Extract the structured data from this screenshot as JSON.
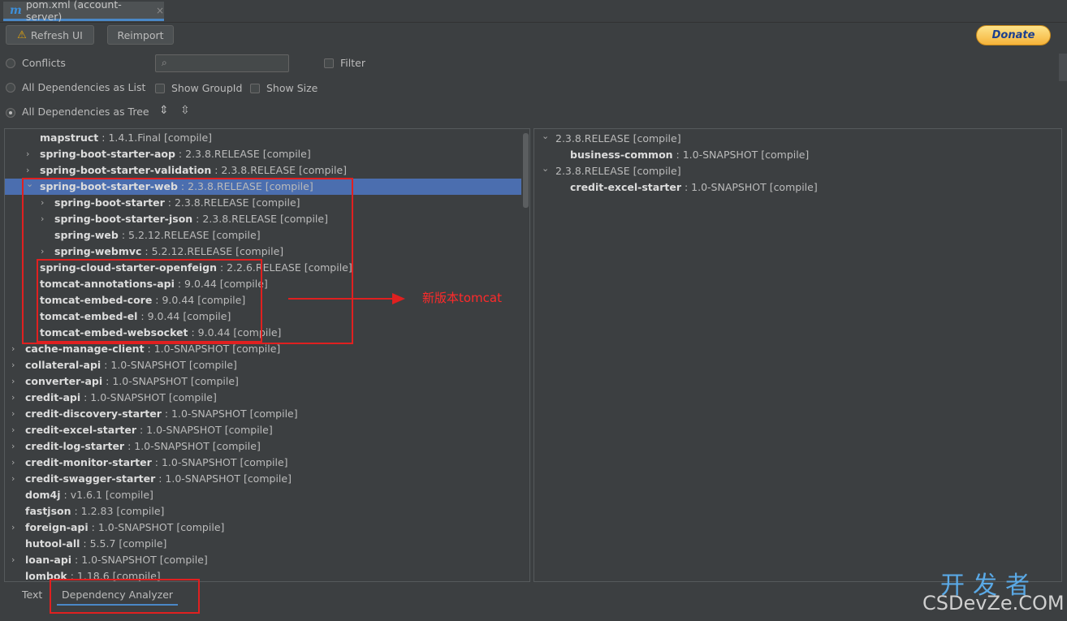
{
  "tab": {
    "title": "pom.xml (account-server)",
    "icon": "m",
    "close": "×"
  },
  "toolbar": {
    "refresh_label": "Refresh UI",
    "reimport_label": "Reimport",
    "donate_label": "Donate"
  },
  "options": {
    "conflicts": "Conflicts",
    "filter": "Filter",
    "as_list": "All Dependencies as List",
    "show_group_id": "Show GroupId",
    "show_size": "Show Size",
    "as_tree": "All Dependencies as Tree"
  },
  "tree": [
    {
      "name": "mapstruct",
      "version": " : 1.4.1.Final [compile]",
      "level": 1,
      "arrow": ""
    },
    {
      "name": "spring-boot-starter-aop",
      "version": " : 2.3.8.RELEASE [compile]",
      "level": 1,
      "arrow": "›"
    },
    {
      "name": "spring-boot-starter-validation",
      "version": " : 2.3.8.RELEASE [compile]",
      "level": 1,
      "arrow": "›"
    },
    {
      "name": "spring-boot-starter-web",
      "version": " : 2.3.8.RELEASE [compile]",
      "level": 1,
      "arrow": "⌄",
      "selected": true
    },
    {
      "name": "spring-boot-starter",
      "version": " : 2.3.8.RELEASE [compile]",
      "level": 2,
      "arrow": "›"
    },
    {
      "name": "spring-boot-starter-json",
      "version": " : 2.3.8.RELEASE [compile]",
      "level": 2,
      "arrow": "›"
    },
    {
      "name": "spring-web",
      "version": " : 5.2.12.RELEASE [compile]",
      "level": 2,
      "arrow": ""
    },
    {
      "name": "spring-webmvc",
      "version": " : 5.2.12.RELEASE [compile]",
      "level": 2,
      "arrow": "›"
    },
    {
      "name": "spring-cloud-starter-openfeign",
      "version": " : 2.2.6.RELEASE [compile]",
      "level": 1,
      "arrow": ""
    },
    {
      "name": "tomcat-annotations-api",
      "version": " : 9.0.44 [compile]",
      "level": 1,
      "arrow": ""
    },
    {
      "name": "tomcat-embed-core",
      "version": " : 9.0.44 [compile]",
      "level": 1,
      "arrow": ""
    },
    {
      "name": "tomcat-embed-el",
      "version": " : 9.0.44 [compile]",
      "level": 1,
      "arrow": ""
    },
    {
      "name": "tomcat-embed-websocket",
      "version": " : 9.0.44 [compile]",
      "level": 1,
      "arrow": ""
    },
    {
      "name": "cache-manage-client",
      "version": " : 1.0-SNAPSHOT [compile]",
      "level": 0,
      "arrow": "›"
    },
    {
      "name": "collateral-api",
      "version": " : 1.0-SNAPSHOT [compile]",
      "level": 0,
      "arrow": "›"
    },
    {
      "name": "converter-api",
      "version": " : 1.0-SNAPSHOT [compile]",
      "level": 0,
      "arrow": "›"
    },
    {
      "name": "credit-api",
      "version": " : 1.0-SNAPSHOT [compile]",
      "level": 0,
      "arrow": "›"
    },
    {
      "name": "credit-discovery-starter",
      "version": " : 1.0-SNAPSHOT [compile]",
      "level": 0,
      "arrow": "›"
    },
    {
      "name": "credit-excel-starter",
      "version": " : 1.0-SNAPSHOT [compile]",
      "level": 0,
      "arrow": "›"
    },
    {
      "name": "credit-log-starter",
      "version": " : 1.0-SNAPSHOT [compile]",
      "level": 0,
      "arrow": "›"
    },
    {
      "name": "credit-monitor-starter",
      "version": " : 1.0-SNAPSHOT [compile]",
      "level": 0,
      "arrow": "›"
    },
    {
      "name": "credit-swagger-starter",
      "version": " : 1.0-SNAPSHOT [compile]",
      "level": 0,
      "arrow": "›"
    },
    {
      "name": "dom4j",
      "version": " : v1.6.1 [compile]",
      "level": 0,
      "arrow": ""
    },
    {
      "name": "fastjson",
      "version": " : 1.2.83 [compile]",
      "level": 0,
      "arrow": ""
    },
    {
      "name": "foreign-api",
      "version": " : 1.0-SNAPSHOT [compile]",
      "level": 0,
      "arrow": "›"
    },
    {
      "name": "hutool-all",
      "version": " : 5.5.7 [compile]",
      "level": 0,
      "arrow": ""
    },
    {
      "name": "loan-api",
      "version": " : 1.0-SNAPSHOT [compile]",
      "level": 0,
      "arrow": "›"
    },
    {
      "name": "lombok",
      "version": " : 1.18.6 [compile]",
      "level": 0,
      "arrow": ""
    }
  ],
  "usages": [
    {
      "name": "",
      "version": "2.3.8.RELEASE [compile]",
      "level": 0,
      "arrow": "⌄"
    },
    {
      "name": "business-common",
      "version": " : 1.0-SNAPSHOT [compile]",
      "level": 1,
      "arrow": ""
    },
    {
      "name": "",
      "version": "2.3.8.RELEASE [compile]",
      "level": 0,
      "arrow": "⌄"
    },
    {
      "name": "credit-excel-starter",
      "version": " : 1.0-SNAPSHOT [compile]",
      "level": 1,
      "arrow": ""
    }
  ],
  "bottom_tabs": {
    "text": "Text",
    "analyzer": "Dependency Analyzer"
  },
  "annotation": {
    "note": "新版本tomcat"
  },
  "watermark": {
    "line1": "开发者",
    "line2": "CSDevZe.COM"
  },
  "colors": {
    "selection": "#4b6eaf",
    "accent": "#4a88c7",
    "annotation": "#e02020"
  }
}
